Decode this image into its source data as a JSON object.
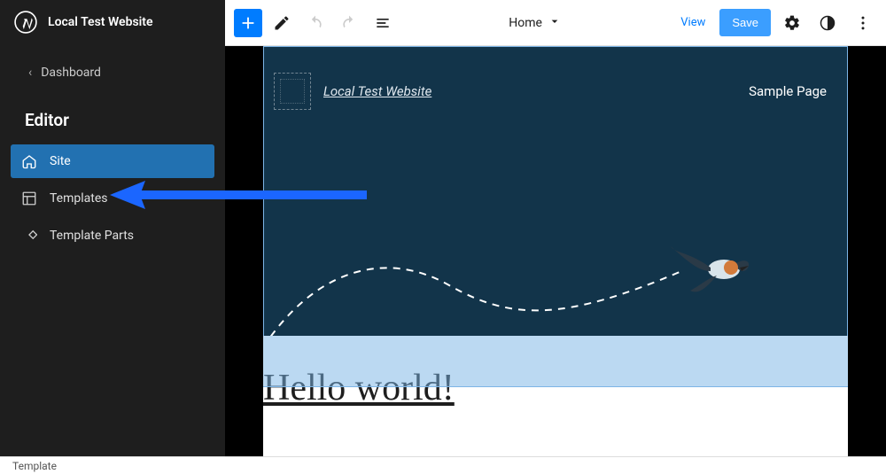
{
  "sidebar": {
    "site_title": "Local Test Website",
    "back_label": "Dashboard",
    "section_label": "Editor",
    "nav": [
      {
        "label": "Site",
        "icon": "home-icon",
        "active": true
      },
      {
        "label": "Templates",
        "icon": "template-icon",
        "active": false
      },
      {
        "label": "Template Parts",
        "icon": "parts-icon",
        "active": false
      }
    ]
  },
  "toolbar": {
    "doc_label": "Home",
    "view_label": "View",
    "save_label": "Save"
  },
  "hero": {
    "site_link": "Local Test Website",
    "nav_item": "Sample Page"
  },
  "content": {
    "heading": "Hello world!"
  },
  "footer": {
    "breadcrumb": "Template"
  },
  "colors": {
    "accent": "#007cff",
    "sidebar_bg": "#1e1e1e",
    "active_nav": "#2271b1",
    "hero_bg": "#12344a"
  }
}
